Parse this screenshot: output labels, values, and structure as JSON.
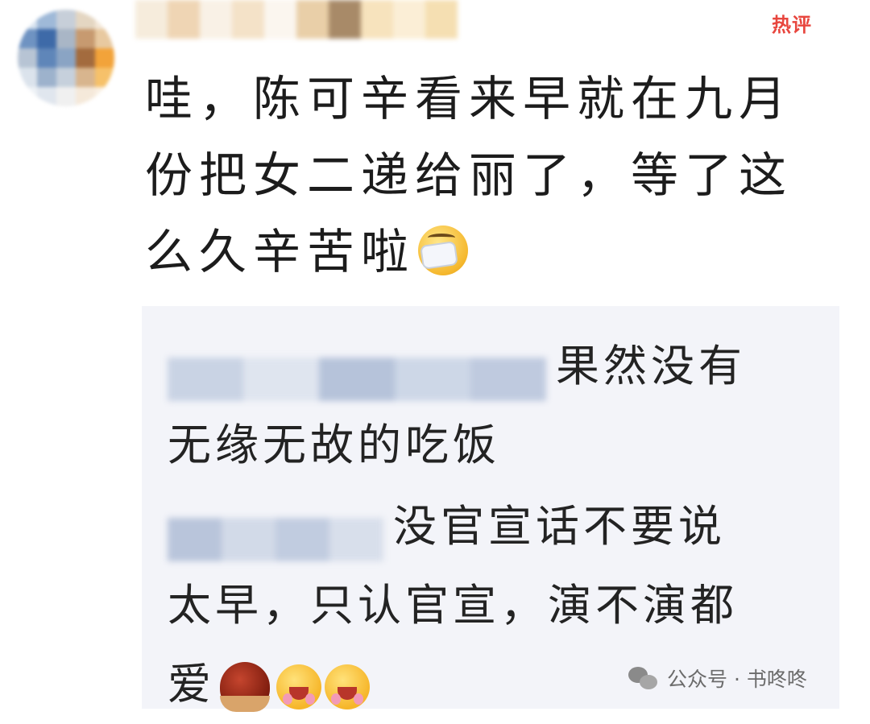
{
  "badge": {
    "hot_label": "热评"
  },
  "comment": {
    "text": "哇，陈可辛看来早就在九月份把女二递给丽了，等了这么久辛苦啦"
  },
  "replies": [
    {
      "text_line1": "果然没有",
      "text_rest": "无缘无故的吃饭"
    },
    {
      "text_line1": "没官宣话不要说",
      "text_line2": "太早，只认官宣，演不演都",
      "text_line3": "爱"
    }
  ],
  "watermark": {
    "label": "公众号 · 书咚咚"
  },
  "icons": [
    "avatar-blurred",
    "hot-badge",
    "mask-face-emoji",
    "chestnut-emoji",
    "laugh-emoji",
    "wechat-icon"
  ],
  "colors": {
    "hot_badge": "#e8463e",
    "reply_bg": "#f3f4f9",
    "text": "#1c1c1c"
  }
}
